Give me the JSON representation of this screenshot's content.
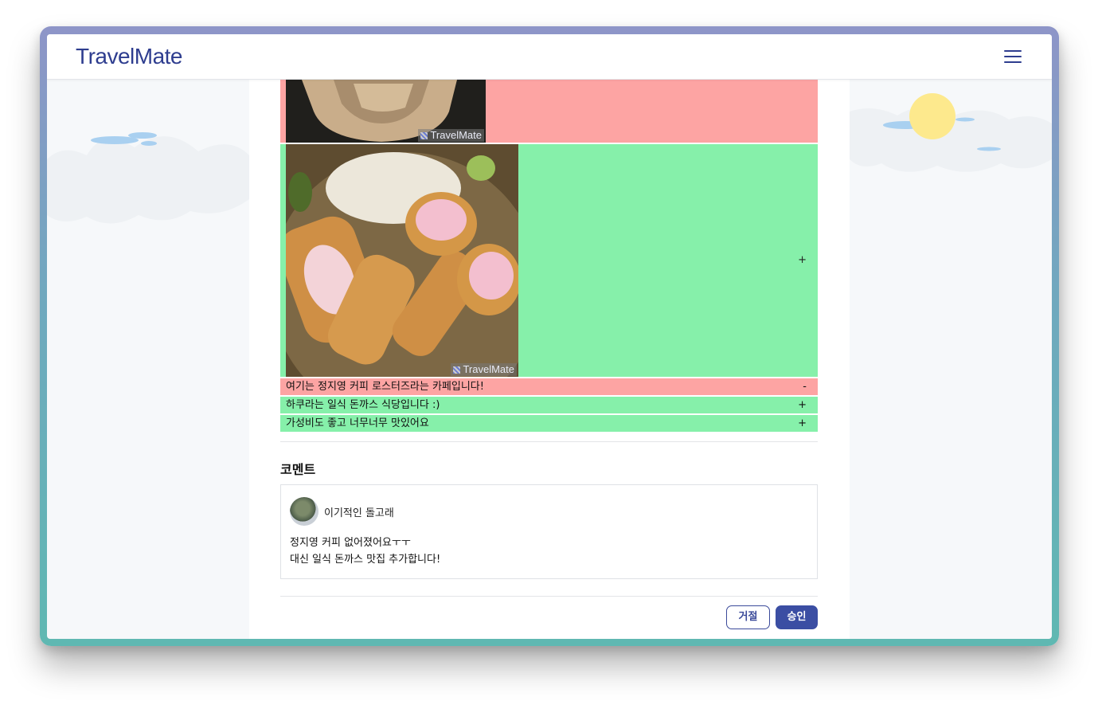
{
  "app": {
    "logo": "TravelMate",
    "menu_icon": "hamburger-menu-icon"
  },
  "colors": {
    "brand": "#2e3d8f",
    "removed_row": "#fda4a3",
    "added_row": "#86f0aa",
    "primary_button": "#3b4ea3"
  },
  "diff": {
    "photos": [
      {
        "status": "removed",
        "sign": "",
        "watermark": "TravelMate"
      },
      {
        "status": "added",
        "sign": "+",
        "watermark": "TravelMate"
      }
    ],
    "lines": [
      {
        "status": "removed",
        "text": "여기는 정지영 커피 로스터즈라는 카페입니다!",
        "sign": "-"
      },
      {
        "status": "added",
        "text": "하쿠라는 일식 돈까스 식당입니다 :)",
        "sign": "+"
      },
      {
        "status": "added",
        "text": "가성비도 좋고 너무너무 맛있어요",
        "sign": "+"
      }
    ]
  },
  "comments": {
    "title": "코멘트",
    "items": [
      {
        "author": "이기적인 돌고래",
        "body": "정지영 커피 없어졌어요ㅜㅜ\n대신 일식 돈까스 맛집 추가합니다!"
      }
    ]
  },
  "actions": {
    "reject_label": "거절",
    "approve_label": "승인"
  }
}
